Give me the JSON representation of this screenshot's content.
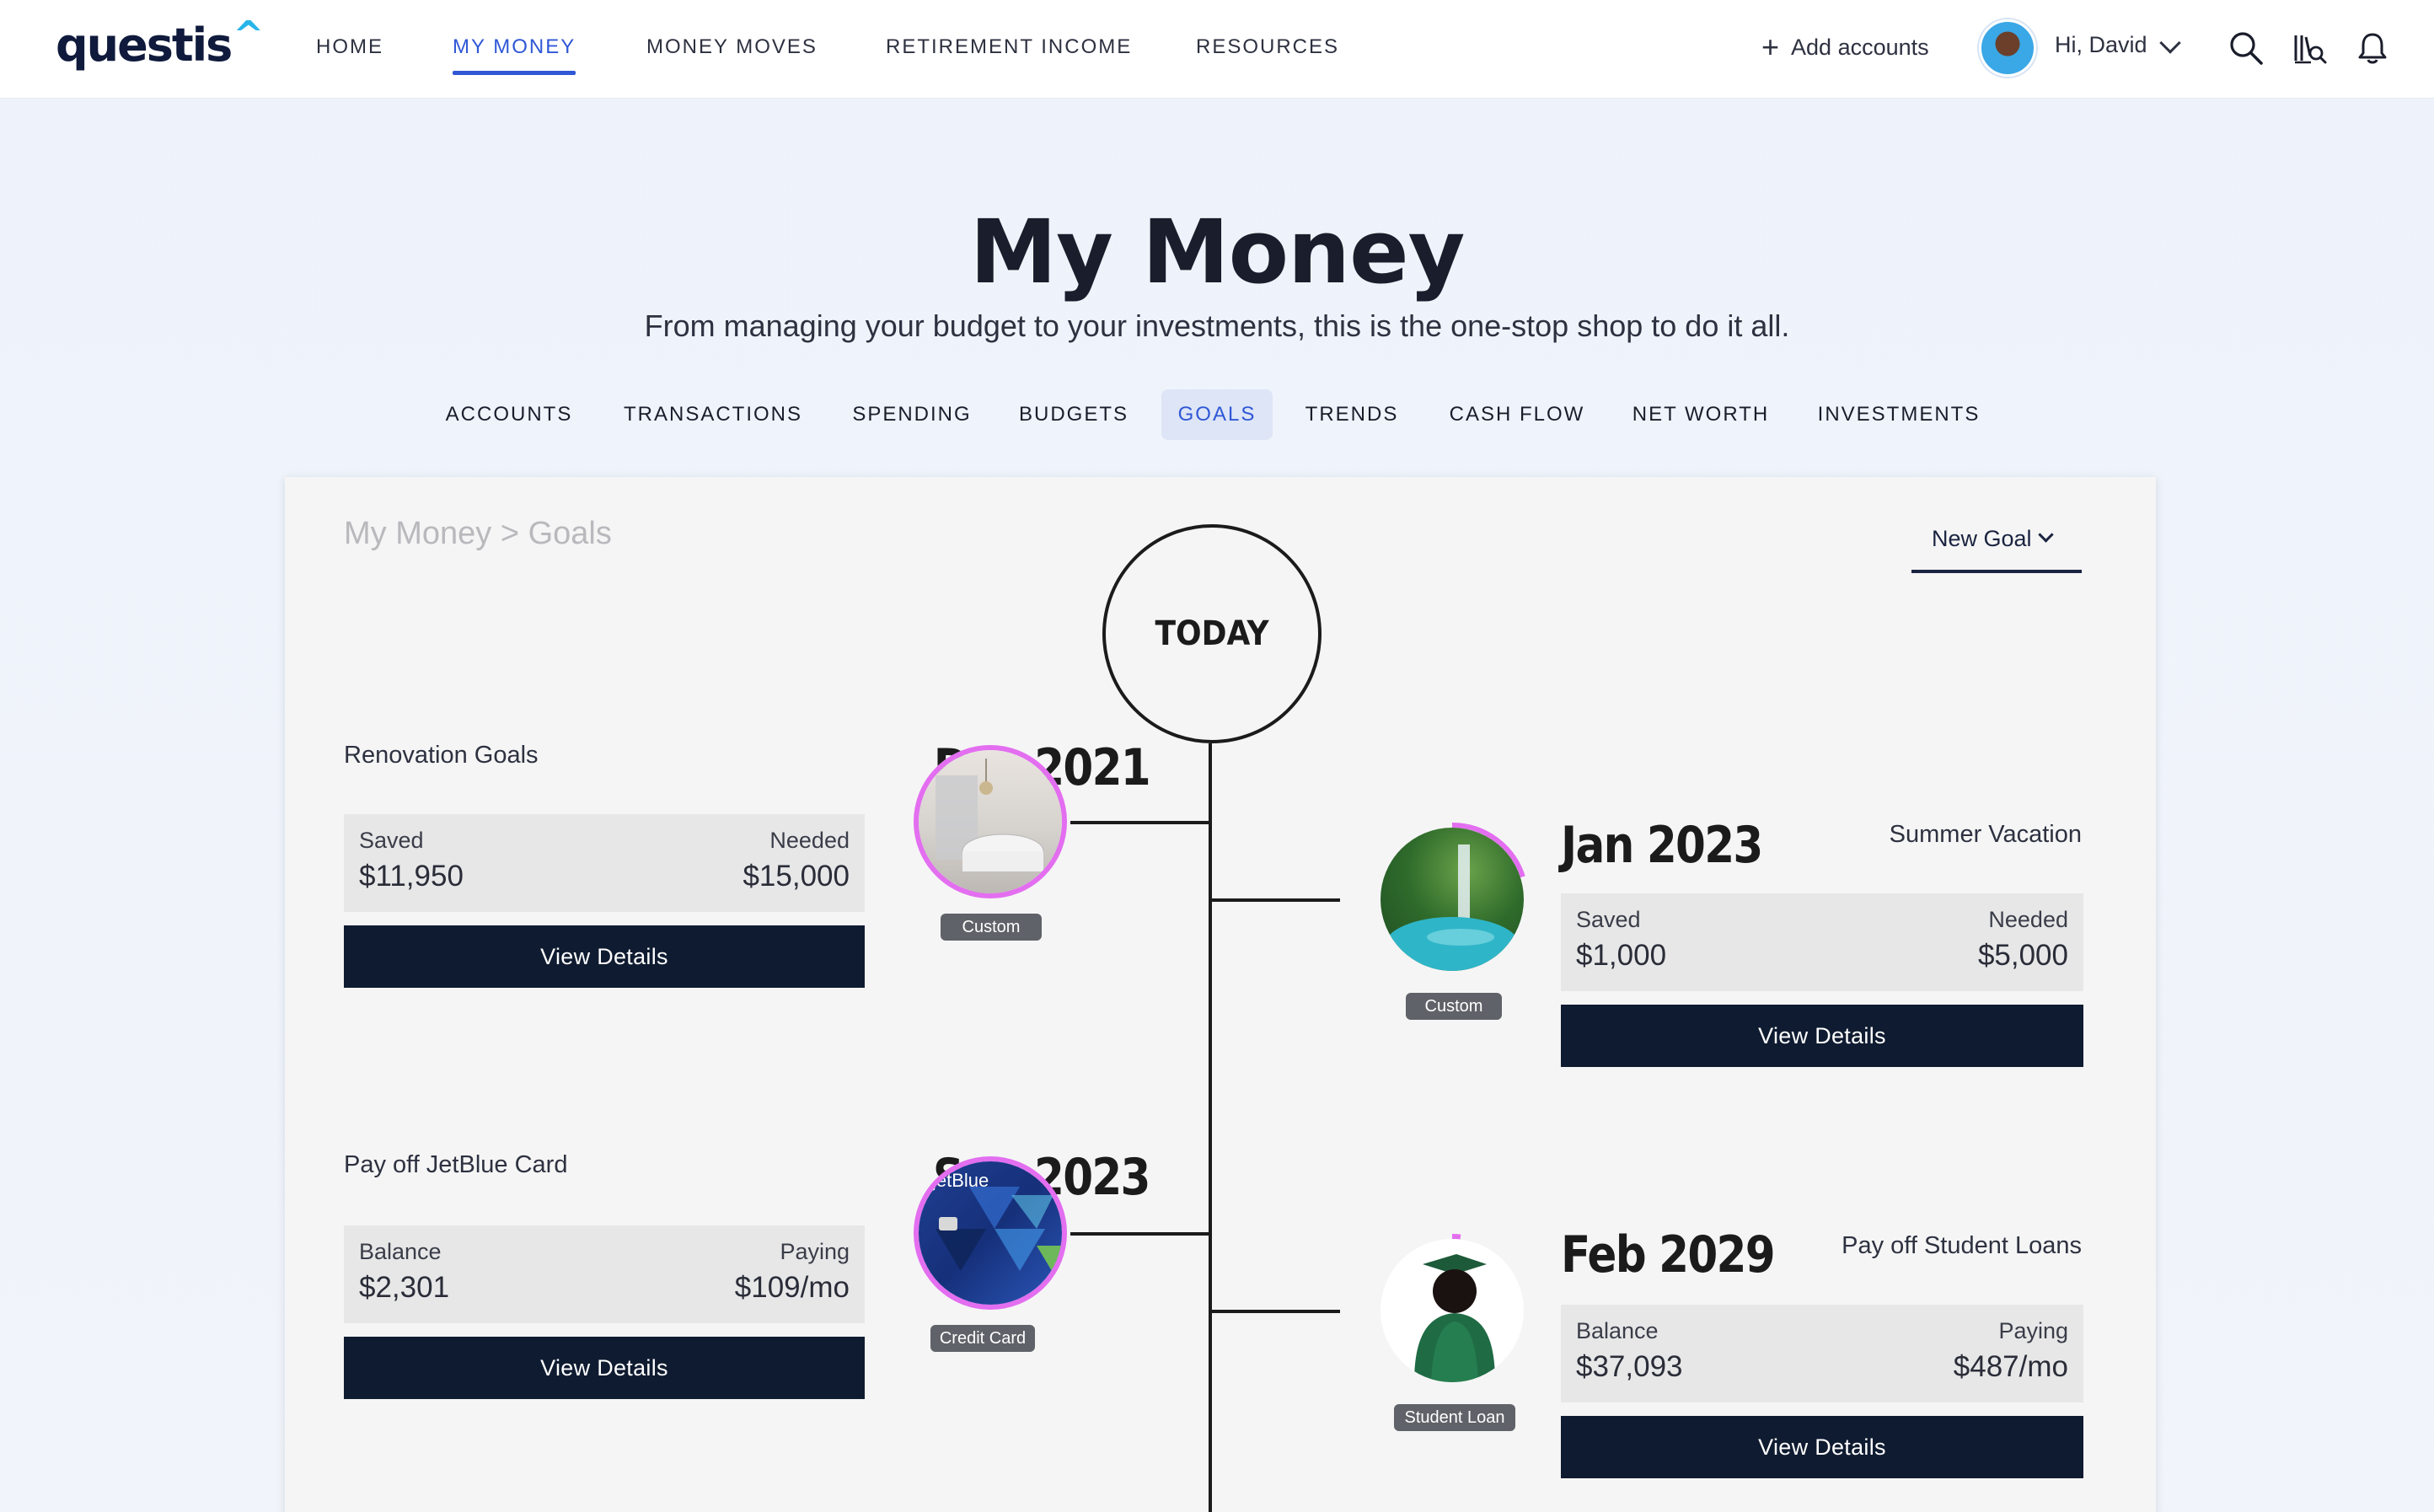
{
  "brand": {
    "name": "questis",
    "caret": "^",
    "accent": "#27b5e9"
  },
  "topnav": {
    "items": [
      {
        "label": "HOME"
      },
      {
        "label": "MY MONEY",
        "active": true
      },
      {
        "label": "MONEY MOVES"
      },
      {
        "label": "RETIREMENT INCOME"
      },
      {
        "label": "RESOURCES"
      }
    ],
    "add_accounts": "Add accounts",
    "greeting": "Hi, David",
    "icons": [
      "plus-icon",
      "avatar",
      "chevron-down-icon",
      "search-icon",
      "library-search-icon",
      "bell-icon"
    ]
  },
  "header": {
    "title": "My Money",
    "subtitle": "From managing your budget to your investments, this is the one-stop shop to do it all."
  },
  "subnav": {
    "items": [
      {
        "label": "ACCOUNTS"
      },
      {
        "label": "TRANSACTIONS"
      },
      {
        "label": "SPENDING"
      },
      {
        "label": "BUDGETS"
      },
      {
        "label": "GOALS",
        "active": true
      },
      {
        "label": "TRENDS"
      },
      {
        "label": "CASH FLOW"
      },
      {
        "label": "NET WORTH"
      },
      {
        "label": "INVESTMENTS"
      }
    ]
  },
  "goals_panel": {
    "breadcrumb": "My Money > Goals",
    "new_goal_label": "New Goal",
    "today_label": "TODAY",
    "goals": [
      {
        "name": "Renovation Goals",
        "date": "Dec 2021",
        "stat1_label": "Saved",
        "stat1_value": "$11,950",
        "stat2_label": "Needed",
        "stat2_value": "$15,000",
        "button": "View Details",
        "tag": "Custom",
        "photo": "bathroom-photo",
        "ring_color": "#e36ef0"
      },
      {
        "name": "Summer Vacation",
        "date": "Jan 2023",
        "stat1_label": "Saved",
        "stat1_value": "$1,000",
        "stat2_label": "Needed",
        "stat2_value": "$5,000",
        "button": "View Details",
        "tag": "Custom",
        "photo": "waterfall-photo",
        "ring_color": "#e36ef0"
      },
      {
        "name": "Pay off JetBlue Card",
        "date": "Sep 2023",
        "stat1_label": "Balance",
        "stat1_value": "$2,301",
        "stat2_label": "Paying",
        "stat2_value": "$109/mo",
        "button": "View Details",
        "tag": "Credit Card",
        "photo": "jetblue-card-photo",
        "ring_color": "#e36ef0",
        "card_text": "jetBlue"
      },
      {
        "name": "Pay off Student Loans",
        "date": "Feb 2029",
        "stat1_label": "Balance",
        "stat1_value": "$37,093",
        "stat2_label": "Paying",
        "stat2_value": "$487/mo",
        "button": "View Details",
        "tag": "Student Loan",
        "photo": "graduate-photo",
        "ring_color": "#e36ef0"
      }
    ]
  },
  "colors": {
    "nav_active": "#2f57d6",
    "button_dark": "#0f1b30",
    "subnav_active_bg": "#dde5f6",
    "progress_ring": "#e36ef0"
  }
}
